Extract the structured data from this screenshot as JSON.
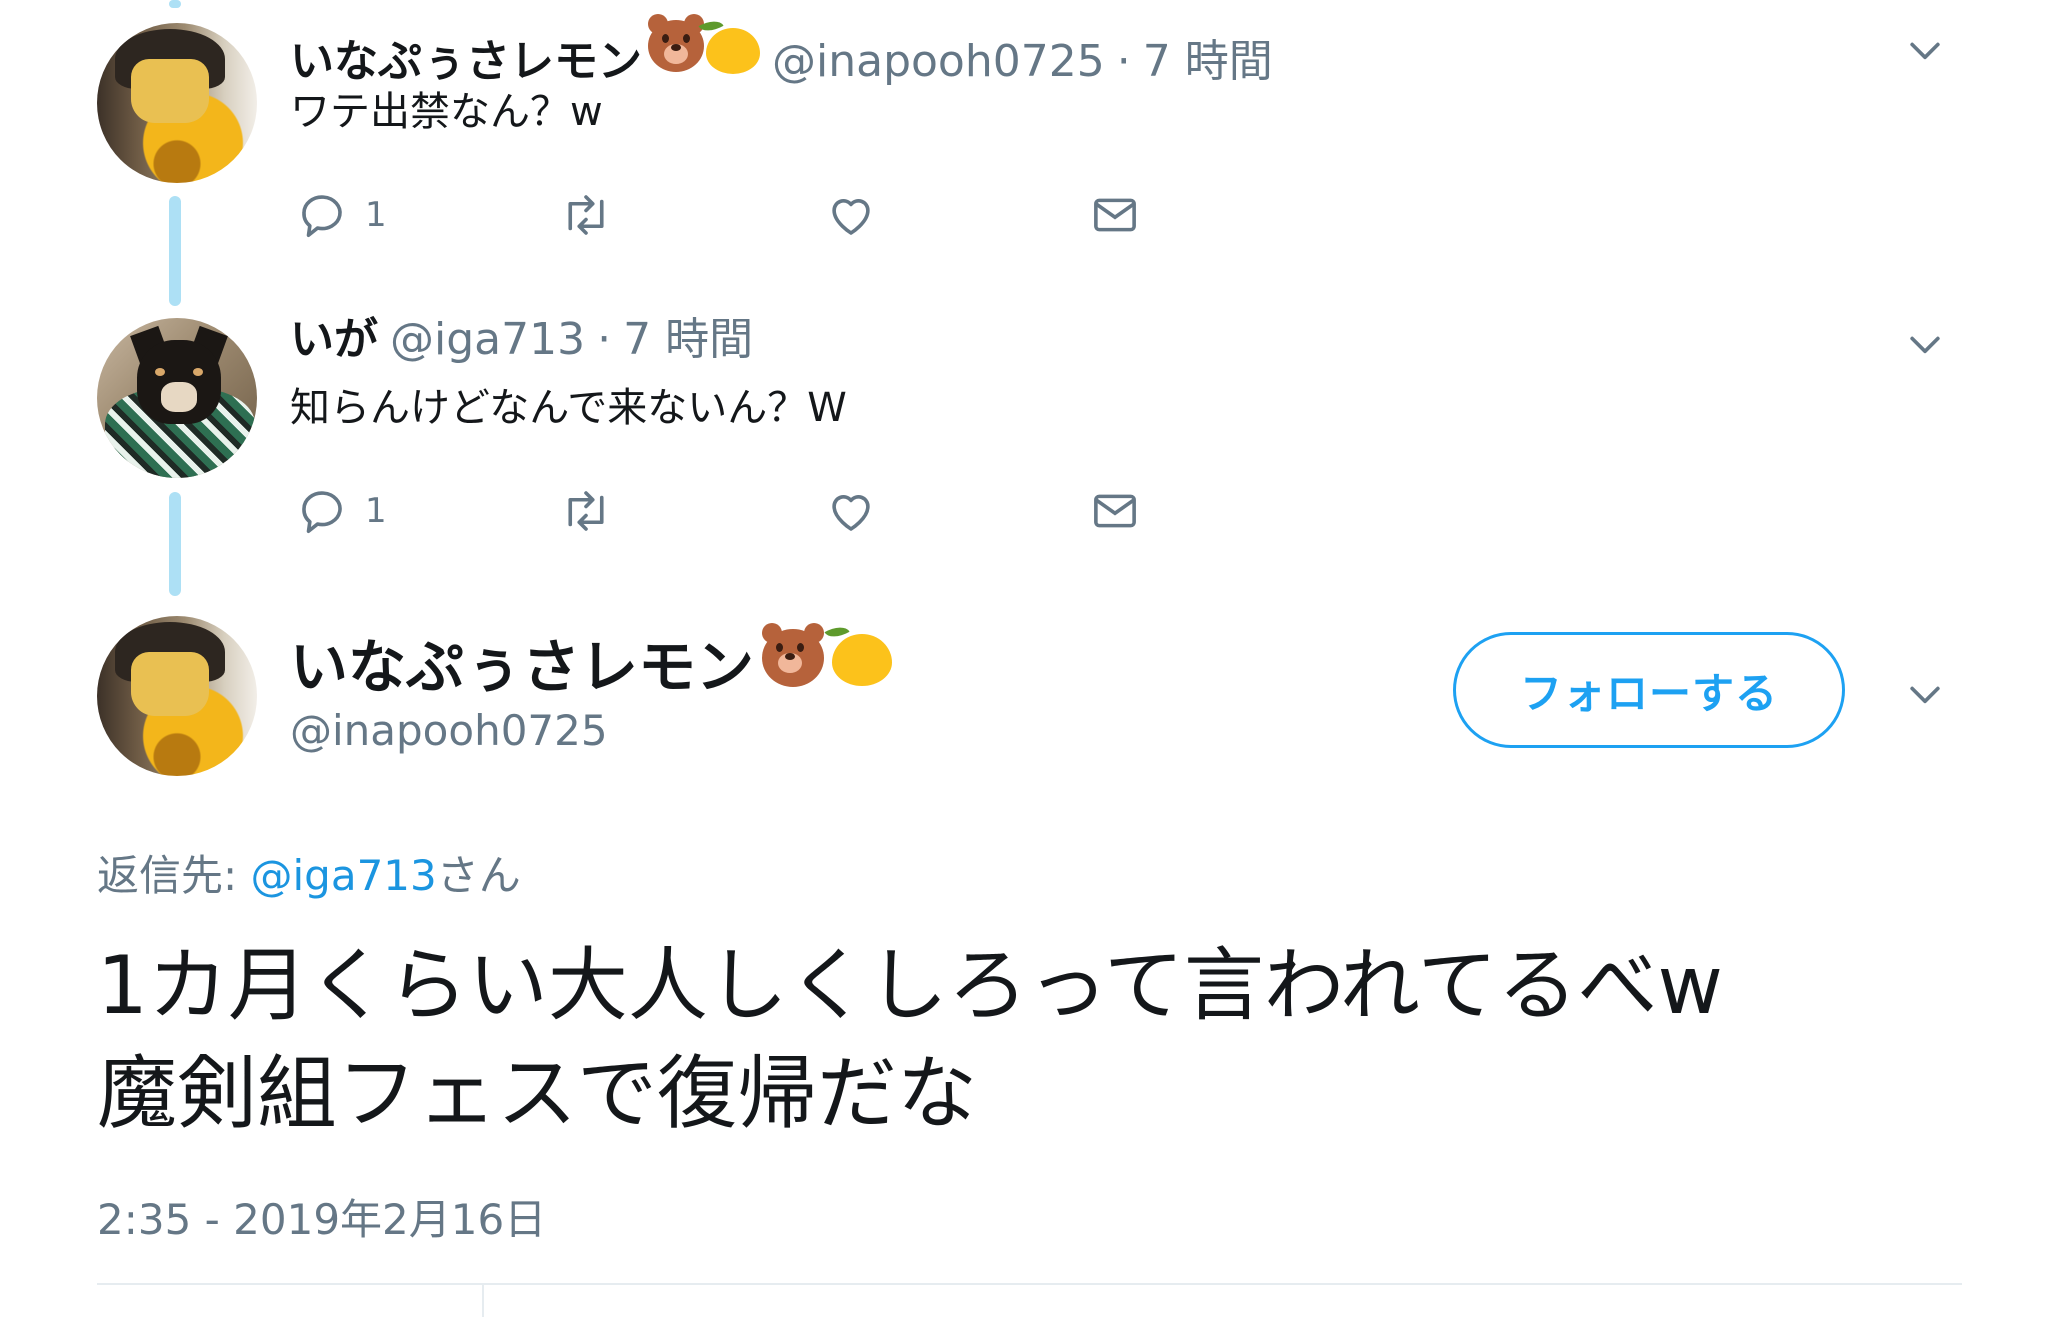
{
  "tweets": [
    {
      "display_name": "いなぷぅさレモン",
      "handle": "@inapooh0725",
      "time": "7 時間",
      "dot": "·",
      "text": "ワテ出禁なん？w",
      "reply_count": "1",
      "emoji": [
        "bear-face",
        "lemon"
      ]
    },
    {
      "display_name": "いが",
      "handle": "@iga713",
      "time": "7 時間",
      "dot": "·",
      "text": "知らんけどなんで来ないん？W",
      "reply_count": "1",
      "emoji": []
    }
  ],
  "main_tweet": {
    "display_name": "いなぷぅさレモン",
    "handle": "@inapooh0725",
    "follow_label": "フォローする",
    "reply_to_prefix": "返信先: ",
    "reply_to_mention": "@iga713",
    "reply_to_suffix": "さん",
    "text_lines": [
      "1カ月くらい大人しくしろって言われてるべw",
      "魔剣組フェスで復帰だな"
    ],
    "timestamp": "2:35 - 2019年2月16日"
  },
  "colors": {
    "accent": "#1da1f2",
    "mention": "#1b95e0",
    "secondary_text": "#657786",
    "thread_line": "#ade0f5"
  },
  "icons": [
    "reply-icon",
    "retweet-icon",
    "like-icon",
    "direct-message-icon",
    "chevron-down-icon"
  ]
}
